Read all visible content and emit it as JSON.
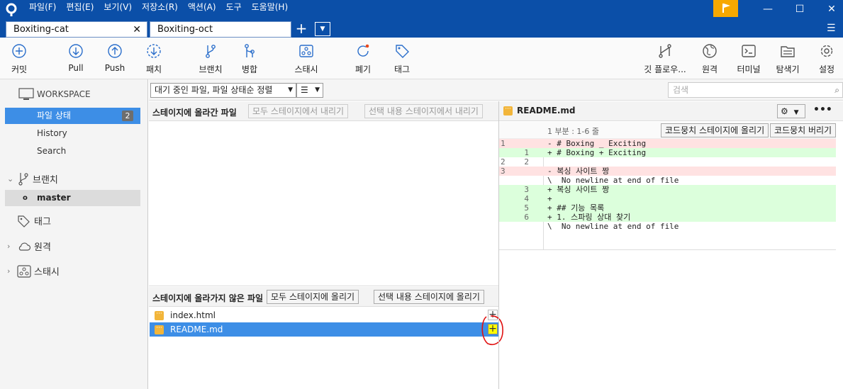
{
  "menu": [
    "파일(F)",
    "편집(E)",
    "보기(V)",
    "저장소(R)",
    "액션(A)",
    "도구",
    "도움말(H)"
  ],
  "tabs": [
    {
      "label": "Boxiting-cat"
    },
    {
      "label": "Boxiting-oct"
    }
  ],
  "toolbar": {
    "commit": "커밋",
    "pull": "Pull",
    "push": "Push",
    "fetch": "패치",
    "branch": "브랜치",
    "merge": "병합",
    "stash": "스태시",
    "discard": "폐기",
    "tag": "태그",
    "gitflow": "깃 플로우...",
    "remote": "원격",
    "terminal": "터미널",
    "explorer": "탐색기",
    "settings": "설정"
  },
  "sidebar": {
    "workspace": "WORKSPACE",
    "file_status": "파일 상태",
    "file_status_count": "2",
    "history": "History",
    "search": "Search",
    "branches": "브랜치",
    "master": "master",
    "tags": "태그",
    "remotes": "원격",
    "stashes": "스태시"
  },
  "filter": {
    "dropdown": "대기 중인 파일, 파일 상태순 정렬",
    "search_placeholder": "검색"
  },
  "staged": {
    "title": "스테이지에 올라간 파일",
    "unstage_all": "모두 스테이지에서 내리기",
    "unstage_selected": "선택 내용 스테이지에서 내리기"
  },
  "unstaged": {
    "title": "스테이지에 올라가지 않은 파일",
    "stage_all": "모두 스테이지에 올리기",
    "stage_selected": "선택 내용 스테이지에 올리기",
    "files": [
      {
        "name": "index.html"
      },
      {
        "name": "README.md"
      }
    ]
  },
  "diff": {
    "file": "README.md",
    "hunk_header": "1 부분 : 1-6 줄",
    "stage_hunk": "코드뭉치 스테이지에 올리기",
    "discard_hunk": "코드뭉치 버리기",
    "lines": [
      {
        "old": "1",
        "new": "",
        "type": "del",
        "text": "- # Boxing _ Exciting"
      },
      {
        "old": "",
        "new": "1",
        "type": "add",
        "text": "+ # Boxing + Exciting"
      },
      {
        "old": "2",
        "new": "2",
        "type": "ctx",
        "text": ""
      },
      {
        "old": "3",
        "new": "",
        "type": "del",
        "text": "- 복싱 사이트 짱"
      },
      {
        "old": "",
        "new": "",
        "type": "ctx",
        "text": "\\  No newline at end of file"
      },
      {
        "old": "",
        "new": "3",
        "type": "add",
        "text": "+ 복싱 사이트 짱"
      },
      {
        "old": "",
        "new": "4",
        "type": "add",
        "text": "+"
      },
      {
        "old": "",
        "new": "5",
        "type": "add",
        "text": "+ ## 기능 목록"
      },
      {
        "old": "",
        "new": "6",
        "type": "add",
        "text": "+ 1. 스파링 상대 찾기"
      },
      {
        "old": "",
        "new": "",
        "type": "ctx",
        "text": "\\  No newline at end of file"
      }
    ]
  }
}
